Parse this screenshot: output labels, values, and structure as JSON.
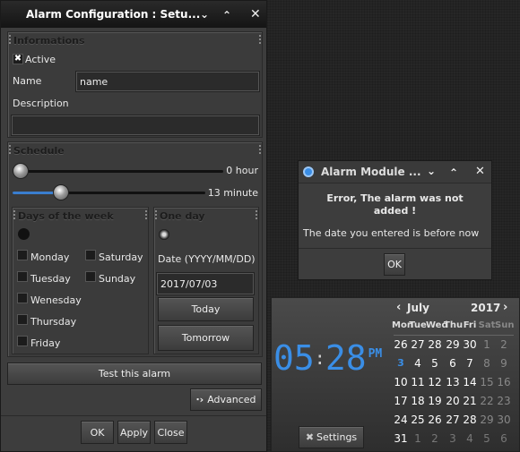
{
  "main_window": {
    "title": "Alarm Configuration : Setu...",
    "informations": {
      "title": "Informations",
      "active_label": "Active",
      "active_checked": true,
      "name_label": "Name",
      "name_value": "name",
      "description_label": "Description",
      "description_value": ""
    },
    "schedule": {
      "title": "Schedule",
      "hour_value": 0,
      "hour_label": "0 hour",
      "hour_max": 23,
      "minute_value": 13,
      "minute_label": "13 minute",
      "minute_max": 59
    },
    "days_of_week": {
      "title": "Days of the week",
      "selected": false,
      "days": [
        {
          "label": "Monday",
          "checked": false
        },
        {
          "label": "Saturday",
          "checked": false
        },
        {
          "label": "Tuesday",
          "checked": false
        },
        {
          "label": "Sunday",
          "checked": false
        },
        {
          "label": "Wenesday",
          "checked": false
        },
        {
          "label": "Thursday",
          "checked": false
        },
        {
          "label": "Friday",
          "checked": false
        }
      ]
    },
    "one_day": {
      "title": "One day",
      "selected": true,
      "date_label": "Date (YYYY/MM/DD)",
      "date_value": "2017/07/03",
      "today_label": "Today",
      "tomorrow_label": "Tomorrow"
    },
    "test_label": "Test this alarm",
    "advanced_label": "Advanced",
    "ok_label": "OK",
    "apply_label": "Apply",
    "close_label": "Close"
  },
  "error_dialog": {
    "title": "Alarm Module ...",
    "heading": "Error, The alarm was not added !",
    "message": "The date you entered is before now",
    "ok_label": "OK",
    "accent": "#3a8ee6"
  },
  "clock": {
    "hours": "05",
    "minutes": "28",
    "separator": ":",
    "ampm": "PM",
    "color": "#3a8ee6",
    "settings_label": "Settings",
    "calendar": {
      "month": "July",
      "year": "2017",
      "weekdays": [
        "Mon",
        "Tue",
        "Wed",
        "Thu",
        "Fri",
        "Sat",
        "Sun"
      ],
      "weeks": [
        [
          {
            "d": "26",
            "t": ""
          },
          {
            "d": "27",
            "t": ""
          },
          {
            "d": "28",
            "t": ""
          },
          {
            "d": "29",
            "t": ""
          },
          {
            "d": "30",
            "t": ""
          },
          {
            "d": "1",
            "t": "weekend"
          },
          {
            "d": "2",
            "t": "weekend"
          }
        ],
        [
          {
            "d": "3",
            "t": "today"
          },
          {
            "d": "4",
            "t": ""
          },
          {
            "d": "5",
            "t": ""
          },
          {
            "d": "6",
            "t": ""
          },
          {
            "d": "7",
            "t": ""
          },
          {
            "d": "8",
            "t": "weekend"
          },
          {
            "d": "9",
            "t": "weekend"
          }
        ],
        [
          {
            "d": "10",
            "t": ""
          },
          {
            "d": "11",
            "t": ""
          },
          {
            "d": "12",
            "t": ""
          },
          {
            "d": "13",
            "t": ""
          },
          {
            "d": "14",
            "t": ""
          },
          {
            "d": "15",
            "t": "weekend"
          },
          {
            "d": "16",
            "t": "weekend"
          }
        ],
        [
          {
            "d": "17",
            "t": ""
          },
          {
            "d": "18",
            "t": ""
          },
          {
            "d": "19",
            "t": ""
          },
          {
            "d": "20",
            "t": ""
          },
          {
            "d": "21",
            "t": ""
          },
          {
            "d": "22",
            "t": "weekend"
          },
          {
            "d": "23",
            "t": "weekend"
          }
        ],
        [
          {
            "d": "24",
            "t": ""
          },
          {
            "d": "25",
            "t": ""
          },
          {
            "d": "26",
            "t": ""
          },
          {
            "d": "27",
            "t": ""
          },
          {
            "d": "28",
            "t": ""
          },
          {
            "d": "29",
            "t": "weekend"
          },
          {
            "d": "30",
            "t": "weekend"
          }
        ],
        [
          {
            "d": "31",
            "t": ""
          },
          {
            "d": "1",
            "t": "muted"
          },
          {
            "d": "2",
            "t": "muted"
          },
          {
            "d": "3",
            "t": "muted"
          },
          {
            "d": "4",
            "t": "muted"
          },
          {
            "d": "5",
            "t": "muted"
          },
          {
            "d": "6",
            "t": "muted"
          }
        ]
      ]
    }
  }
}
